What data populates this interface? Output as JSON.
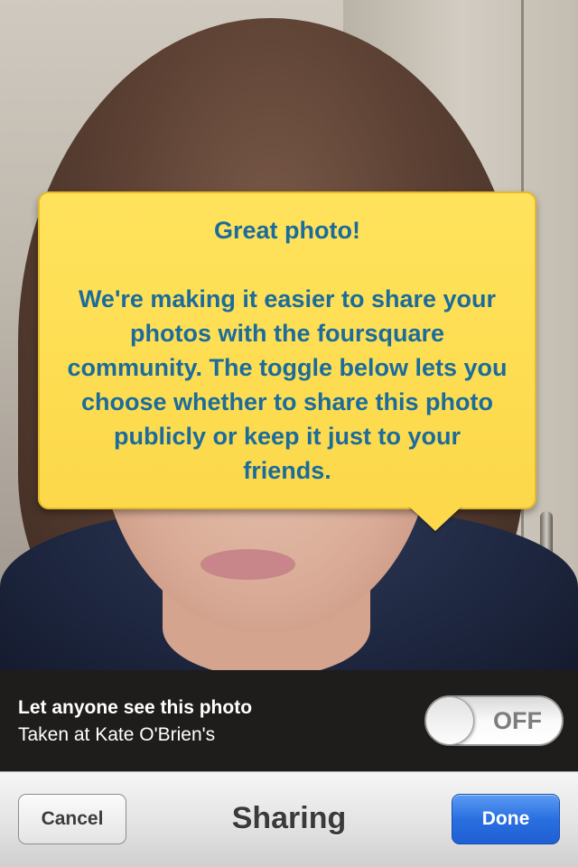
{
  "tooltip": {
    "title": "Great photo!",
    "body": "We're making it easier to share your photos with the foursquare community. The toggle below lets you choose whether to share this photo publicly or keep it just to your friends."
  },
  "share_setting": {
    "label": "Let anyone see this photo",
    "sublabel": "Taken at Kate O'Brien's",
    "toggle_state": "OFF"
  },
  "navbar": {
    "cancel_label": "Cancel",
    "title": "Sharing",
    "done_label": "Done"
  },
  "colors": {
    "tooltip_bg": "#fcd84a",
    "tooltip_text": "#1b6c9c",
    "done_button": "#2a6fe0"
  }
}
